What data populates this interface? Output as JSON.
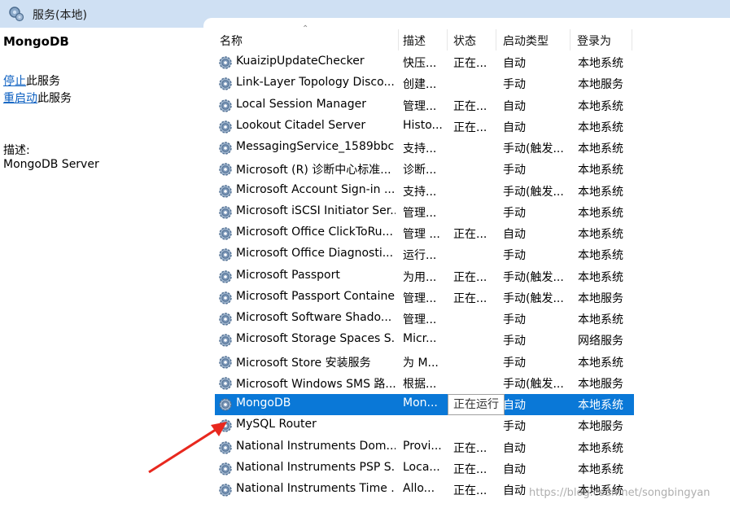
{
  "window": {
    "title": "服务(本地)"
  },
  "left": {
    "service_name": "MongoDB",
    "stop_link": "停止",
    "stop_suffix": "此服务",
    "restart_link": "重启动",
    "restart_suffix": "此服务",
    "desc_label": "描述:",
    "desc_text": "MongoDB Server"
  },
  "columns": {
    "name": "名称",
    "desc": "描述",
    "status": "状态",
    "start": "启动类型",
    "logon": "登录为"
  },
  "rows": [
    {
      "name": "KuaizipUpdateChecker",
      "desc": "快压...",
      "status": "正在...",
      "start": "自动",
      "logon": "本地系统"
    },
    {
      "name": "Link-Layer Topology Disco...",
      "desc": "创建...",
      "status": "",
      "start": "手动",
      "logon": "本地服务"
    },
    {
      "name": "Local Session Manager",
      "desc": "管理...",
      "status": "正在...",
      "start": "自动",
      "logon": "本地系统"
    },
    {
      "name": "Lookout Citadel Server",
      "desc": "Histo...",
      "status": "正在...",
      "start": "自动",
      "logon": "本地系统"
    },
    {
      "name": "MessagingService_1589bbc",
      "desc": "支持...",
      "status": "",
      "start": "手动(触发...",
      "logon": "本地系统"
    },
    {
      "name": "Microsoft (R) 诊断中心标准...",
      "desc": "诊断...",
      "status": "",
      "start": "手动",
      "logon": "本地系统"
    },
    {
      "name": "Microsoft Account Sign-in ...",
      "desc": "支持...",
      "status": "",
      "start": "手动(触发...",
      "logon": "本地系统"
    },
    {
      "name": "Microsoft iSCSI Initiator Ser...",
      "desc": "管理...",
      "status": "",
      "start": "手动",
      "logon": "本地系统"
    },
    {
      "name": "Microsoft Office ClickToRu...",
      "desc": "管理 ...",
      "status": "正在...",
      "start": "自动",
      "logon": "本地系统"
    },
    {
      "name": "Microsoft Office Diagnosti...",
      "desc": "运行...",
      "status": "",
      "start": "手动",
      "logon": "本地系统"
    },
    {
      "name": "Microsoft Passport",
      "desc": "为用...",
      "status": "正在...",
      "start": "手动(触发...",
      "logon": "本地系统"
    },
    {
      "name": "Microsoft Passport Container",
      "desc": "管理...",
      "status": "正在...",
      "start": "手动(触发...",
      "logon": "本地服务"
    },
    {
      "name": "Microsoft Software Shado...",
      "desc": "管理...",
      "status": "",
      "start": "手动",
      "logon": "本地系统"
    },
    {
      "name": "Microsoft Storage Spaces S...",
      "desc": "Micr...",
      "status": "",
      "start": "手动",
      "logon": "网络服务"
    },
    {
      "name": "Microsoft Store 安装服务",
      "desc": "为 M...",
      "status": "",
      "start": "手动",
      "logon": "本地系统"
    },
    {
      "name": "Microsoft Windows SMS 路...",
      "desc": "根据...",
      "status": "",
      "start": "手动(触发...",
      "logon": "本地服务"
    },
    {
      "name": "MongoDB",
      "desc": "Mon...",
      "status": "",
      "start": "自动",
      "logon": "本地系统",
      "selected": true
    },
    {
      "name": "MySQL Router",
      "desc": "",
      "status": "",
      "start": "手动",
      "logon": "本地服务"
    },
    {
      "name": "National Instruments Dom...",
      "desc": "Provi...",
      "status": "正在...",
      "start": "自动",
      "logon": "本地系统"
    },
    {
      "name": "National Instruments PSP S...",
      "desc": "Loca...",
      "status": "正在...",
      "start": "自动",
      "logon": "本地系统"
    },
    {
      "name": "National Instruments Time ...",
      "desc": "Allo...",
      "status": "正在...",
      "start": "自动",
      "logon": "本地系统"
    }
  ],
  "tooltip": "正在运行",
  "watermark": "https://blog.csdn.net/songbingyan"
}
